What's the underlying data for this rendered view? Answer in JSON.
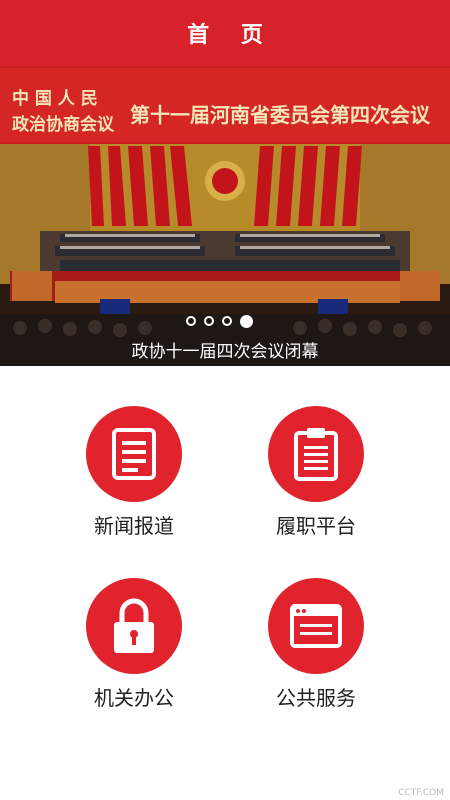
{
  "header": {
    "title": "首 页"
  },
  "banner": {
    "headline_left_top": "中 国 人 民",
    "headline_left_bottom": "政治协商会议",
    "headline_main": "第十一届河南省委员会第四次会议",
    "caption": "政协十一届四次会议闭幕",
    "slide_count": 4,
    "active_slide": 4
  },
  "menu": {
    "items": [
      {
        "label": "新闻报道",
        "icon": "document-list-icon"
      },
      {
        "label": "履职平台",
        "icon": "clipboard-icon"
      },
      {
        "label": "机关办公",
        "icon": "lock-icon"
      },
      {
        "label": "公共服务",
        "icon": "browser-window-icon"
      }
    ]
  },
  "watermark": "CCTF.COM",
  "colors": {
    "accent": "#d7222b",
    "icon_circle": "#e0232c"
  }
}
